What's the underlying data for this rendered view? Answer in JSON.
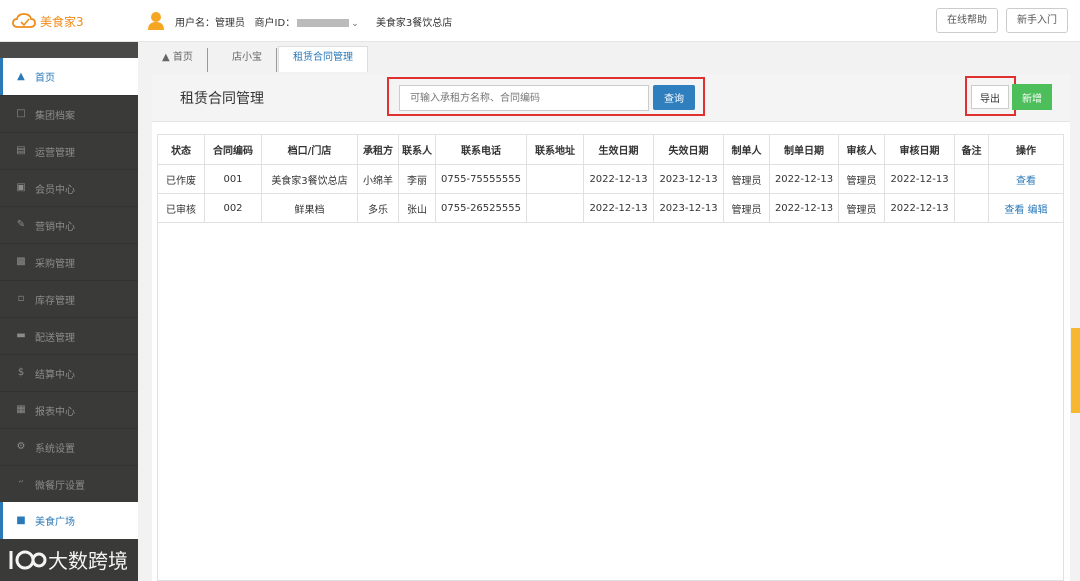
{
  "app": {
    "name": "美食家3"
  },
  "topbar": {
    "user_label": "用户名：管理员",
    "merchant_label": "商户ID：",
    "store_name": "美食家3餐饮总店",
    "help_button": "在线帮助",
    "guide_button": "新手入门"
  },
  "sidebar": {
    "items": [
      {
        "label": "首页",
        "icon": "home-icon"
      },
      {
        "label": "集团档案",
        "icon": "file-icon"
      },
      {
        "label": "运营管理",
        "icon": "chart-icon"
      },
      {
        "label": "会员中心",
        "icon": "card-icon"
      },
      {
        "label": "营销中心",
        "icon": "edit-icon"
      },
      {
        "label": "采购管理",
        "icon": "book-icon"
      },
      {
        "label": "库存管理",
        "icon": "doc-icon"
      },
      {
        "label": "配送管理",
        "icon": "truck-icon"
      },
      {
        "label": "结算中心",
        "icon": "money-icon"
      },
      {
        "label": "报表中心",
        "icon": "report-icon"
      },
      {
        "label": "系统设置",
        "icon": "gears-icon"
      },
      {
        "label": "微餐厅设置",
        "icon": "utensils-icon"
      },
      {
        "label": "美食广场",
        "icon": "plaza-icon"
      }
    ]
  },
  "tabs": [
    {
      "label": "首页"
    },
    {
      "label": "店小宝"
    },
    {
      "label": "租赁合同管理"
    }
  ],
  "page": {
    "title": "租赁合同管理",
    "search_placeholder": "可输入承租方名称、合同编码",
    "search_button": "查询",
    "export_button": "导出",
    "add_button": "新增"
  },
  "table": {
    "headers": [
      "状态",
      "合同编码",
      "档口/门店",
      "承租方",
      "联系人",
      "联系电话",
      "联系地址",
      "生效日期",
      "失效日期",
      "制单人",
      "制单日期",
      "审核人",
      "审核日期",
      "备注",
      "操作"
    ],
    "rows": [
      {
        "status": "已作废",
        "code": "001",
        "store": "美食家3餐饮总店",
        "tenant": "小绵羊",
        "contact": "李丽",
        "phone": "0755-75555555",
        "address": "",
        "start": "2022-12-13",
        "end": "2023-12-13",
        "creator": "管理员",
        "created": "2022-12-13",
        "auditor": "管理员",
        "audited": "2022-12-13",
        "remark": "",
        "view": "查看",
        "edit": ""
      },
      {
        "status": "已审核",
        "code": "002",
        "store": "鲜果档",
        "tenant": "多乐",
        "contact": "张山",
        "phone": "0755-26525555",
        "address": "",
        "start": "2022-12-13",
        "end": "2023-12-13",
        "creator": "管理员",
        "created": "2022-12-13",
        "auditor": "管理员",
        "audited": "2022-12-13",
        "remark": "",
        "view": "查看",
        "edit": "编辑"
      }
    ]
  },
  "watermark": "大数跨境",
  "colors": {
    "accent": "#2a79b8",
    "brand": "#f08c1a",
    "highlight": "#e03030",
    "add": "#4cbf5a"
  }
}
